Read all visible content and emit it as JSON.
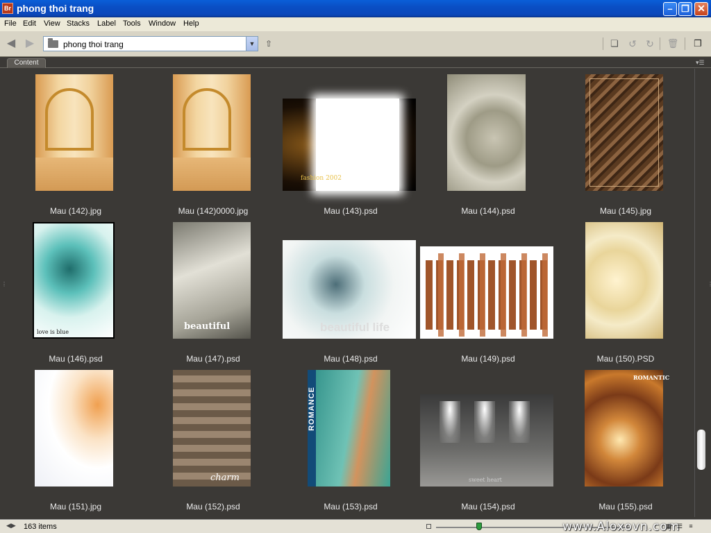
{
  "window": {
    "title": "phong thoi trang",
    "app_icon_label": "Br"
  },
  "menu": [
    "File",
    "Edit",
    "View",
    "Stacks",
    "Label",
    "Tools",
    "Window",
    "Help"
  ],
  "toolbar": {
    "path": "phong thoi trang"
  },
  "panel": {
    "tab_label": "Content"
  },
  "thumbnails": [
    {
      "label": "Mau (142).jpg"
    },
    {
      "label": "Mau (142)0000.jpg"
    },
    {
      "label": "Mau (143).psd",
      "overlay": "fashion 2002"
    },
    {
      "label": "Mau (144).psd"
    },
    {
      "label": "Mau (145).jpg"
    },
    {
      "label": "Mau (146).psd",
      "overlay": "love is blue"
    },
    {
      "label": "Mau (147).psd",
      "overlay": "beautiful"
    },
    {
      "label": "Mau (148).psd",
      "overlay": "beautiful life"
    },
    {
      "label": "Mau (149).psd"
    },
    {
      "label": "Mau (150).PSD"
    },
    {
      "label": "Mau (151).jpg"
    },
    {
      "label": "Mau (152).psd",
      "overlay": "charm"
    },
    {
      "label": "Mau (153).psd",
      "overlay": "ROMANCE"
    },
    {
      "label": "Mau (154).psd",
      "overlay": "sweet heart"
    },
    {
      "label": "Mau (155).psd",
      "overlay": "ROMANTIC"
    }
  ],
  "status": {
    "item_count": "163 items",
    "watermark": "www.Aloxovn.com"
  },
  "colors": {
    "titlebar": "#0a4fc5",
    "panel_bg": "#3b3936",
    "menu_bg": "#ece9d8"
  }
}
